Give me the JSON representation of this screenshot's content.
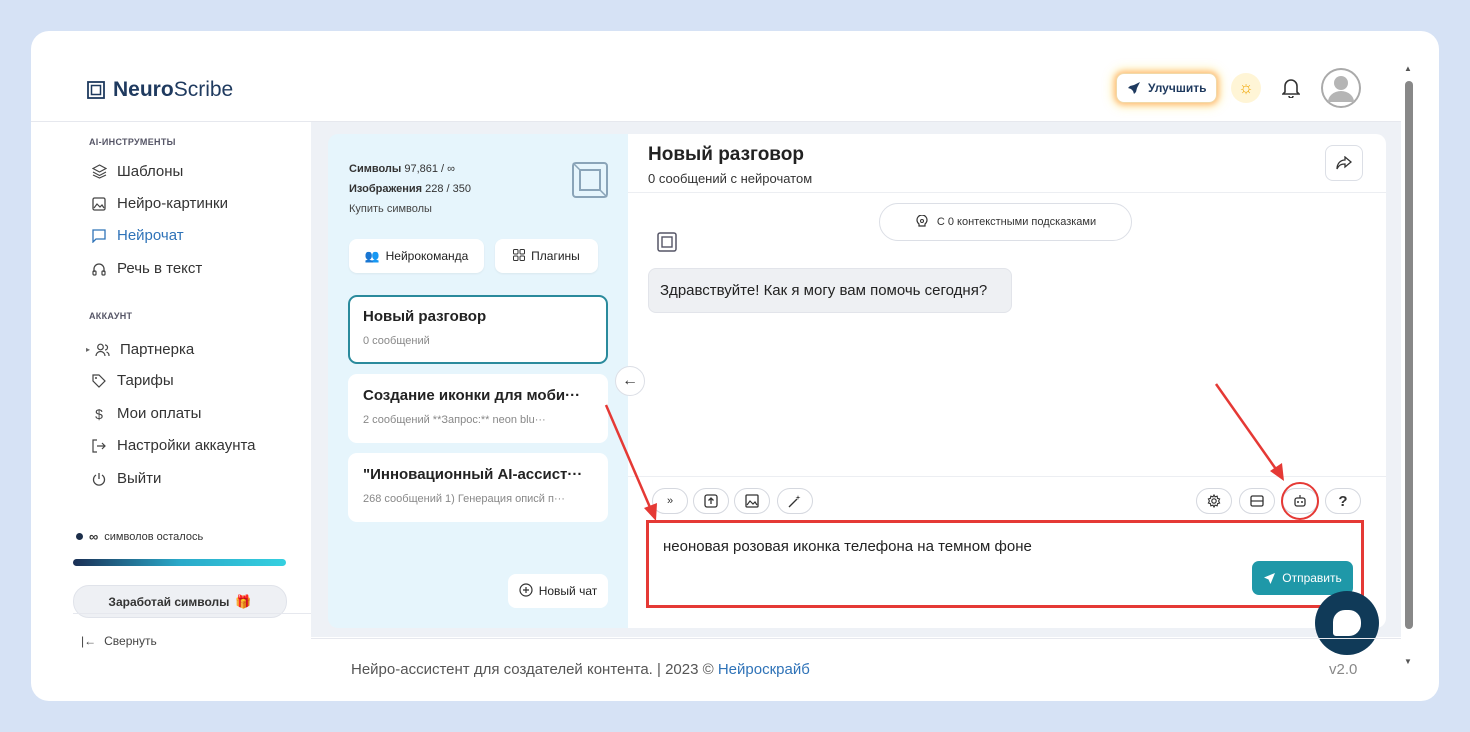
{
  "header": {
    "logo_bold": "Neuro",
    "logo_rest": "Scribe",
    "upgrade_label": "Улучшить"
  },
  "sidebar": {
    "section_tools": "AI-ИНСТРУМЕНТЫ",
    "tools": [
      {
        "label": "Шаблоны",
        "icon": "layers-icon"
      },
      {
        "label": "Нейро-картинки",
        "icon": "image-icon"
      },
      {
        "label": "Нейрочат",
        "icon": "chat-icon",
        "active": true
      },
      {
        "label": "Речь в текст",
        "icon": "headphones-icon"
      }
    ],
    "section_account": "АККАУНТ",
    "account": [
      {
        "label": "Партнерка",
        "icon": "users-icon"
      },
      {
        "label": "Тарифы",
        "icon": "tag-icon"
      },
      {
        "label": "Мои оплаты",
        "icon": "dollar-icon"
      },
      {
        "label": "Настройки аккаунта",
        "icon": "login-icon"
      },
      {
        "label": "Выйти",
        "icon": "power-icon"
      }
    ],
    "credits_symbol": "∞",
    "credits_label": "символов осталось",
    "earn_label": "Заработай символы",
    "collapse_label": "Свернуть"
  },
  "stats": {
    "symbols_label": "Символы",
    "symbols_value": "97,861 / ∞",
    "images_label": "Изображения",
    "images_value": "228 / 350",
    "buy_label": "Купить символы"
  },
  "panel_buttons": {
    "team_label": "Нейрокоманда",
    "plugins_label": "Плагины",
    "new_chat_label": "Новый чат"
  },
  "conversations": [
    {
      "title": "Новый разговор",
      "sub": "0 сообщений",
      "active": true
    },
    {
      "title": "Создание иконки для моби···",
      "sub": "2 сообщений   **Запрос:** neon blu···"
    },
    {
      "title": "\"Инновационный AI-ассист···",
      "sub": "268 сообщений 1) Генерация описй п···"
    }
  ],
  "chat": {
    "title": "Новый разговор",
    "subtitle": "0 сообщений с нейрочатом",
    "hints_label": "С 0 контекстными подсказками",
    "greeting": "Здравствуйте! Как я могу вам помочь сегодня?",
    "input_value": "неоновая розовая иконка телефона на темном фоне",
    "send_label": "Отправить",
    "help_label": "?"
  },
  "footer": {
    "text": "Нейро-ассистент для создателей контента.  | 2023 © ",
    "link": "Нейроскрайб",
    "version": "v2.0"
  },
  "colors": {
    "accent": "#2f73b8",
    "send": "#1f98a8",
    "highlight": "#e53935",
    "panel": "#e6f5fc"
  }
}
